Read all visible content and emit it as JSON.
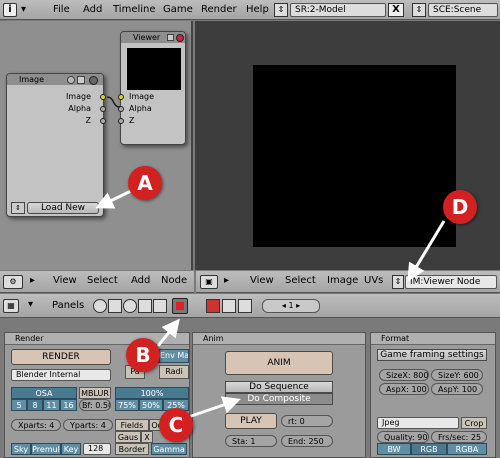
{
  "top_menu": {
    "items": [
      "File",
      "Add",
      "Timeline",
      "Game",
      "Render",
      "Help"
    ],
    "screen": "SR:2-Model",
    "close": "X",
    "scene": "SCE:Scene"
  },
  "nodes": {
    "image": {
      "title": "Image",
      "out_image": "Image",
      "out_alpha": "Alpha",
      "out_z": "Z",
      "load_new": "Load New"
    },
    "viewer": {
      "title": "Viewer",
      "in_image": "Image",
      "in_alpha": "Alpha",
      "in_z": "Z"
    }
  },
  "node_header": {
    "items": [
      "View",
      "Select",
      "Add",
      "Node"
    ]
  },
  "image_header": {
    "items": [
      "View",
      "Select",
      "Image",
      "UVs"
    ],
    "image_name": "IM:Viewer Node"
  },
  "buttons_header": {
    "panels_label": "Panels",
    "frame": "1"
  },
  "render_panel": {
    "title": "Render",
    "render_label": "RENDER",
    "engine": "Blender Internal",
    "osa": "OSA",
    "osa_values": [
      "5",
      "8",
      "11",
      "16"
    ],
    "mblur": "MBLUR",
    "bf": "Bf: 0.50",
    "percent": "100%",
    "percent_values": [
      "75%",
      "50%",
      "25%"
    ],
    "xparts": "Xparts: 4",
    "yparts": "Yparts: 4",
    "fields": "Fields",
    "gaus": "Gaus",
    "border": "Border",
    "gamma": "Gamma",
    "sky": "Sky",
    "premul": "Premul",
    "key": "Key",
    "key_value": "128",
    "shadow_part": "Sh",
    "envmap_part": "Env Ma",
    "radio": "Radi",
    "pano_part": "Pa",
    "odd_part": "Od",
    "fld_x": "X"
  },
  "anim_panel": {
    "title": "Anim",
    "anim_label": "ANIM",
    "do_sequence": "Do Sequence",
    "do_composite": "Do Composite",
    "play": "PLAY",
    "rt": "rt: 0",
    "sta": "Sta: 1",
    "end": "End: 250"
  },
  "format_panel": {
    "title": "Format",
    "game_framing": "Game framing settings",
    "sizex": "SizeX: 800",
    "sizey": "SizeY: 600",
    "aspx": "AspX: 100",
    "aspy": "AspY: 100",
    "format": "Jpeg",
    "crop": "Crop",
    "quality": "Quality: 90",
    "fps": "Frs/sec: 25",
    "bw": "BW",
    "rgb": "RGB",
    "rgba": "RGBA"
  },
  "callouts": {
    "a": "A",
    "b": "B",
    "c": "C",
    "d": "D"
  },
  "colors": {
    "callout": "#d32020",
    "arrow": "#ffffff",
    "accent": "#5f8fa4"
  }
}
